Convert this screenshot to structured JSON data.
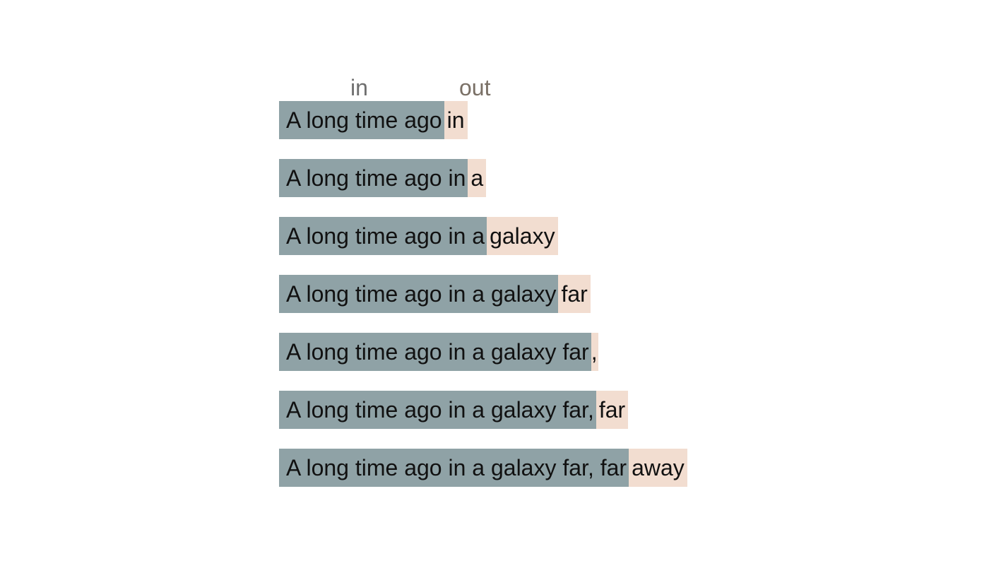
{
  "header": {
    "in_label": "in",
    "out_label": "out"
  },
  "colors": {
    "input_bg": "#8fa2a6",
    "output_bg": "#f2ddd0"
  },
  "rows": [
    {
      "input": "A long time ago",
      "output": "in"
    },
    {
      "input": "A long time ago in",
      "output": "a"
    },
    {
      "input": "A long time ago in a",
      "output": "galaxy"
    },
    {
      "input": "A long time ago in a galaxy",
      "output": "far"
    },
    {
      "input": "A long time ago in a galaxy far",
      "output": ","
    },
    {
      "input": "A long time ago in a galaxy far,",
      "output": "far"
    },
    {
      "input": "A long time ago in a galaxy far, far",
      "output": "away"
    }
  ]
}
